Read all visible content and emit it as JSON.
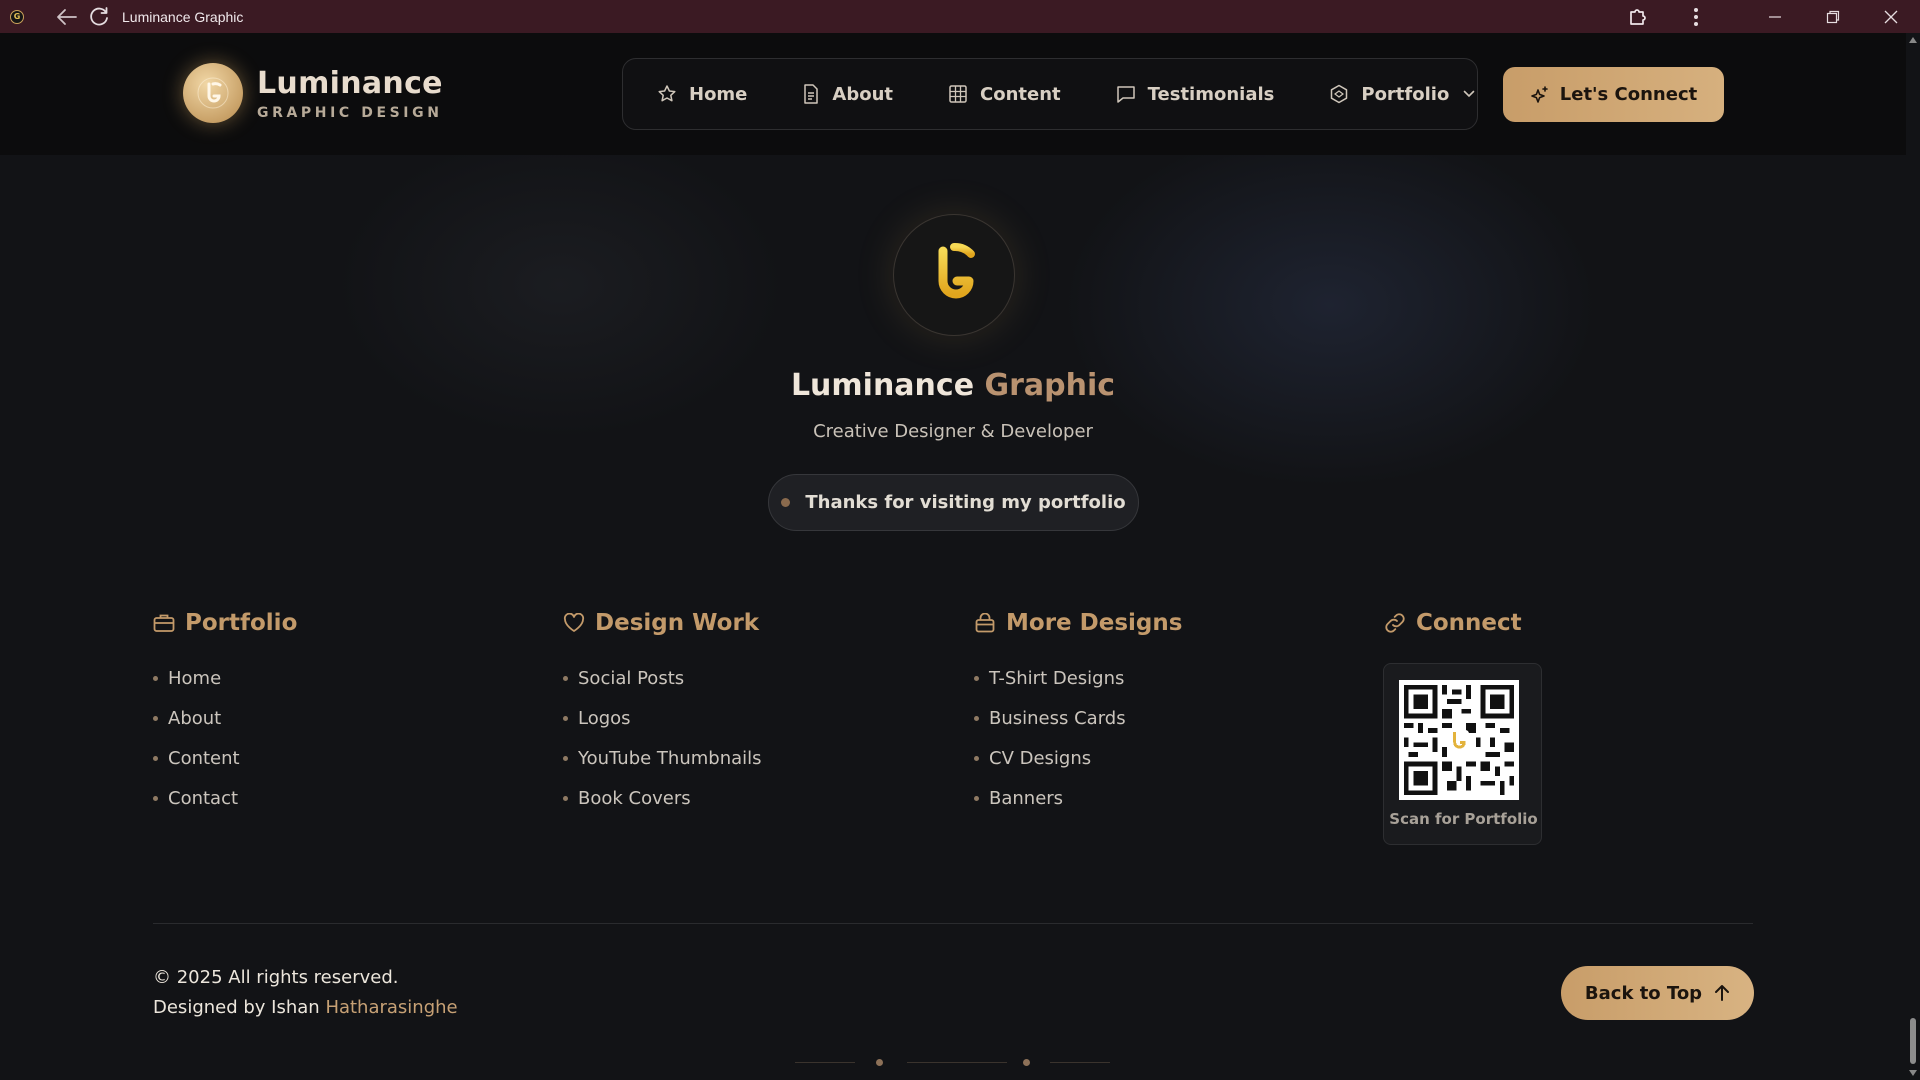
{
  "browser": {
    "tab_title": "Luminance Graphic",
    "favicon_letter": "G"
  },
  "header": {
    "brand_name": "Luminance",
    "brand_sub": "GRAPHIC DESIGN",
    "nav": [
      {
        "label": "Home",
        "icon": "star-icon"
      },
      {
        "label": "About",
        "icon": "document-icon"
      },
      {
        "label": "Content",
        "icon": "grid-icon"
      },
      {
        "label": "Testimonials",
        "icon": "message-icon"
      },
      {
        "label": "Portfolio",
        "icon": "hexagon-icon"
      }
    ],
    "cta_label": "Let's Connect"
  },
  "hero": {
    "title_part1": "Luminance",
    "title_part2": "Graphic",
    "subtitle": "Creative Designer & Developer",
    "pill_text": "Thanks for visiting my portfolio"
  },
  "columns": [
    {
      "heading": "Portfolio",
      "icon": "briefcase-icon",
      "items": [
        "Home",
        "About",
        "Content",
        "Contact"
      ]
    },
    {
      "heading": "Design Work",
      "icon": "heart-icon",
      "items": [
        "Social Posts",
        "Logos",
        "YouTube Thumbnails",
        "Book Covers"
      ]
    },
    {
      "heading": "More Designs",
      "icon": "bag-icon",
      "items": [
        "T-Shirt Designs",
        "Business Cards",
        "CV Designs",
        "Banners"
      ]
    },
    {
      "heading": "Connect",
      "icon": "link-icon",
      "qr_label": "Scan for Portfolio"
    }
  ],
  "bottom": {
    "copyright": "© 2025 All rights reserved.",
    "designed_by_prefix": "Designed by Ishan",
    "designer_surname": "Hatharasinghe",
    "back_to_top": "Back to Top"
  },
  "colors": {
    "accent_gold": "#c89d69",
    "title_bar": "#3b1a23",
    "background": "#121316"
  }
}
